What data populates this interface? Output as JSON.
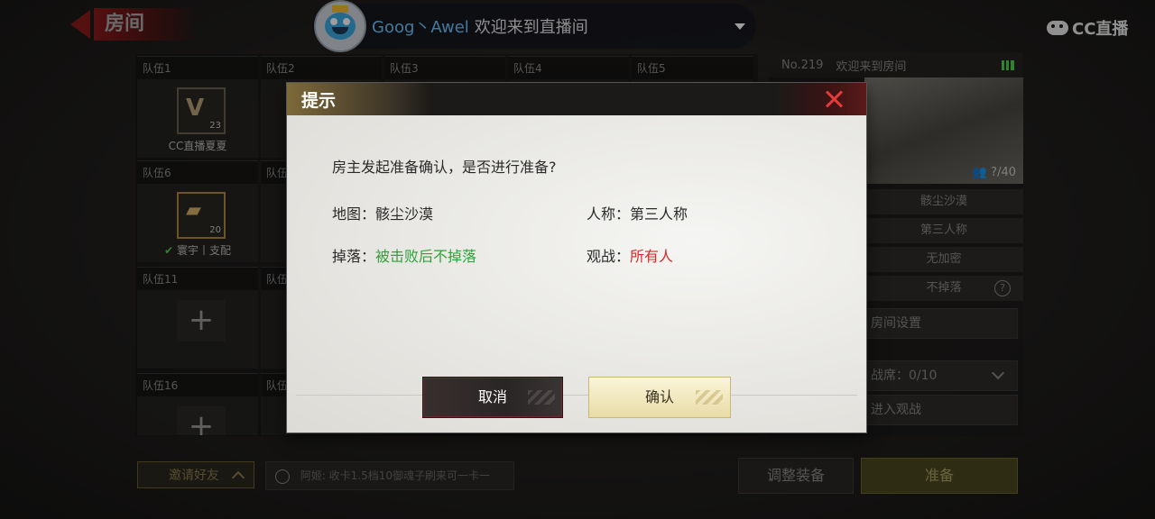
{
  "top": {
    "room_title": "房间",
    "streamer_name": "Goog丶Awel",
    "welcome": "欢迎来到直播间",
    "cc_logo": "CC直播"
  },
  "teams": [
    {
      "label": "队伍1",
      "badge_mark": "V",
      "badge_num": "23",
      "player": "CC直播夏夏"
    },
    {
      "label": "队伍2"
    },
    {
      "label": "队伍3"
    },
    {
      "label": "队伍4"
    },
    {
      "label": "队伍5"
    },
    {
      "label": "队伍6",
      "badge_mark": "▰",
      "badge_num": "20",
      "player": "寰宇丨支配"
    },
    {
      "label": "队伍"
    },
    {
      "label": "队伍11"
    },
    {
      "label": "队伍"
    },
    {
      "label": "队伍16"
    },
    {
      "label": "队伍"
    }
  ],
  "right_panel": {
    "room_no": "No.219",
    "room_welcome": "欢迎来到房间",
    "player_count": "?/40",
    "map": "骸尘沙漠",
    "perspective": "第三人称",
    "password": "无加密",
    "drop": "不掉落",
    "settings": "房间设置",
    "spectator_seats": "战席：0/10",
    "join_spectate": "进入观战"
  },
  "bottom": {
    "invite": "邀请好友",
    "chat": "阿姬: 收卡1.5档10御魂子刷来可一卡一",
    "adjust": "调整装备",
    "ready": "准备"
  },
  "dialog": {
    "title": "提示",
    "prompt": "房主发起准备确认，是否进行准备?",
    "map_label": "地图：",
    "map_value": "骸尘沙漠",
    "perspective_label": "人称：",
    "perspective_value": "第三人称",
    "drop_label": "掉落：",
    "drop_value": "被击败后不掉落",
    "spectate_label": "观战：",
    "spectate_value": "所有人",
    "cancel": "取消",
    "confirm": "确认"
  }
}
